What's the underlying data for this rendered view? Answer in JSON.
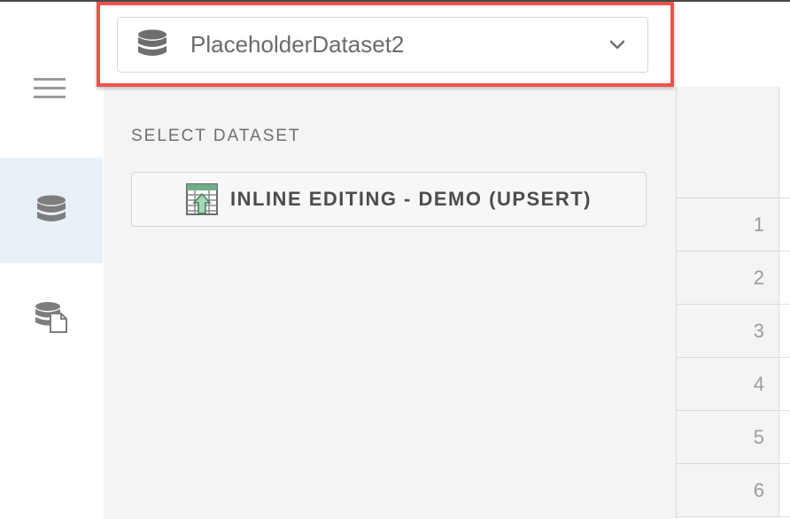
{
  "sidebar": {
    "menu_icon": "hamburger-menu-icon",
    "items": [
      {
        "name": "datasets",
        "icon": "database-icon",
        "active": true
      },
      {
        "name": "dataset-files",
        "icon": "database-file-icon",
        "active": false
      }
    ]
  },
  "header": {
    "selected_dataset": "PlaceholderDataset2",
    "selector_icon": "database-icon",
    "chevron_icon": "chevron-down-icon"
  },
  "dropdown": {
    "heading": "SELECT DATASET",
    "options": [
      {
        "label": "INLINE EDITING - DEMO (UPSERT)",
        "icon": "spreadsheet-upload-icon"
      }
    ]
  },
  "grid": {
    "row_numbers": [
      "1",
      "2",
      "3",
      "4",
      "5",
      "6"
    ]
  },
  "colors": {
    "highlight": "#f0524a",
    "active_nav_bg": "#e9f1f8",
    "panel_bg": "#f4f4f4",
    "text_muted": "#6f6f6f"
  }
}
